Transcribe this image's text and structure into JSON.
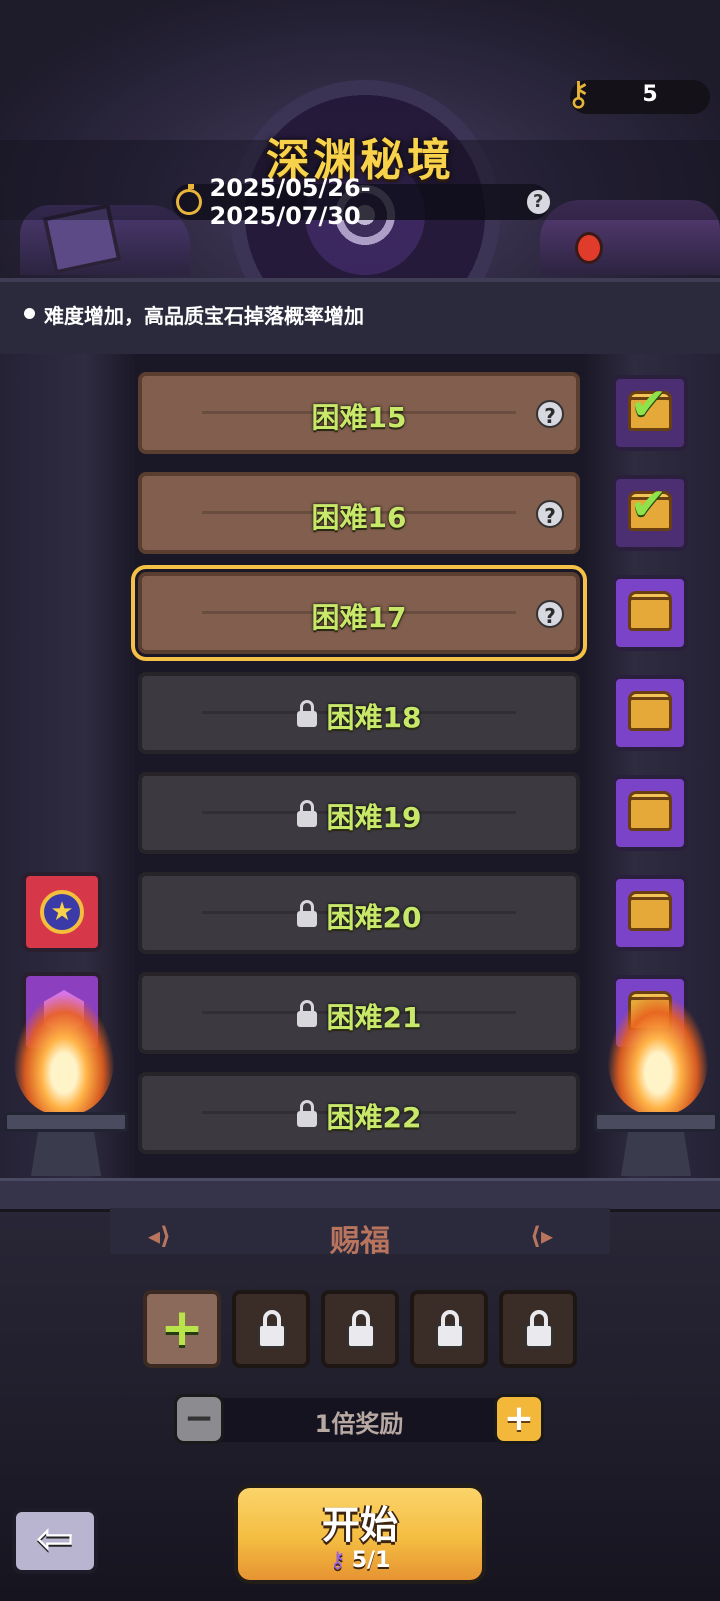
{
  "header": {
    "title": "深渊秘境",
    "date_range": "2025/05/26-2025/07/30",
    "help_icon": "?",
    "key_count": "5"
  },
  "notice": {
    "text": "难度增加，高品质宝石掉落概率增加"
  },
  "levels": [
    {
      "label": "困难15",
      "state": "completed",
      "help": "?",
      "chest": "opened"
    },
    {
      "label": "困难16",
      "state": "completed",
      "help": "?",
      "chest": "opened"
    },
    {
      "label": "困难17",
      "state": "selected",
      "help": "?",
      "chest": "available"
    },
    {
      "label": "困难18",
      "state": "locked",
      "chest": "available"
    },
    {
      "label": "困难19",
      "state": "locked",
      "chest": "available"
    },
    {
      "label": "困难20",
      "state": "locked",
      "chest": "available"
    },
    {
      "label": "困难21",
      "state": "locked",
      "chest": "available"
    },
    {
      "label": "困难22",
      "state": "locked",
      "chest": "available"
    }
  ],
  "blessing": {
    "title": "赐福",
    "slots": [
      "add",
      "locked",
      "locked",
      "locked",
      "locked"
    ]
  },
  "multiplier": {
    "label": "1倍奖励",
    "minus": "−",
    "plus": "+"
  },
  "start_button": {
    "label": "开始",
    "cost": "5/1"
  },
  "colors": {
    "title": "#f7d24a",
    "level_text": "#c8e86a",
    "selected_outline": "#f5c046",
    "chest_purple": "#7a43c8",
    "start_button": "#f4bd41"
  },
  "icons": {
    "key": "key-icon",
    "timer": "timer-icon",
    "back": "back-arrow-icon",
    "lock": "lock-icon",
    "chest": "treasure-chest-icon",
    "check": "checkmark-icon"
  }
}
